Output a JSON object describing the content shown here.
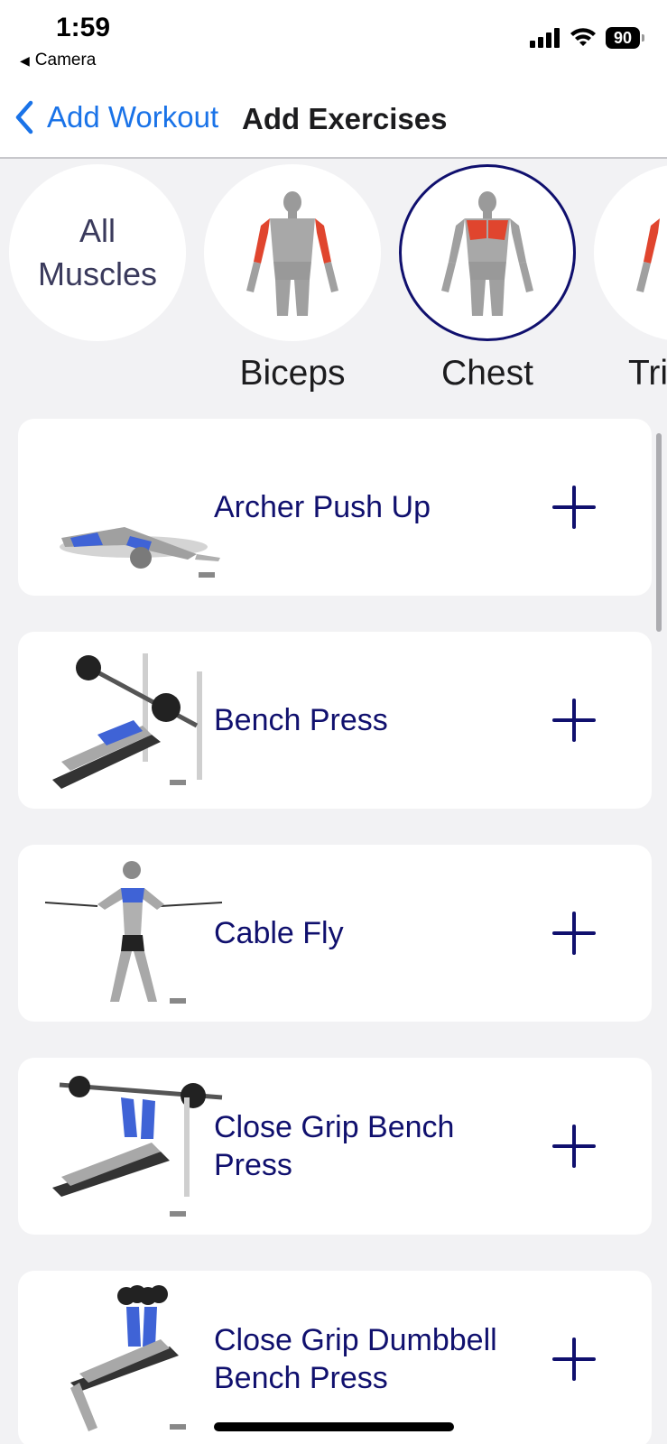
{
  "status_bar": {
    "time": "1:59",
    "back_app": "Camera",
    "battery": "90",
    "icons": [
      "signal-icon",
      "wifi-icon",
      "battery-icon"
    ]
  },
  "nav": {
    "back_label": "Add Workout",
    "title": "Add Exercises"
  },
  "muscles": [
    {
      "label": "All Muscles",
      "selected": false
    },
    {
      "label": "Biceps",
      "selected": false
    },
    {
      "label": "Chest",
      "selected": true
    },
    {
      "label": "Triceps",
      "visible_text": "Tri",
      "selected": false
    }
  ],
  "muscles_all_line1": "All",
  "muscles_all_line2": "Muscles",
  "exercises": [
    {
      "name": "Archer Push Up"
    },
    {
      "name": "Bench Press"
    },
    {
      "name": "Cable Fly"
    },
    {
      "name": "Close Grip Bench Press"
    },
    {
      "name": "Close Grip Dumbbell Bench Press"
    }
  ],
  "colors": {
    "accent": "#10106e",
    "link": "#1a73e8",
    "background": "#f2f2f4",
    "muscle_highlight_red": "#e0452e",
    "muscle_highlight_blue": "#3f63d6"
  }
}
